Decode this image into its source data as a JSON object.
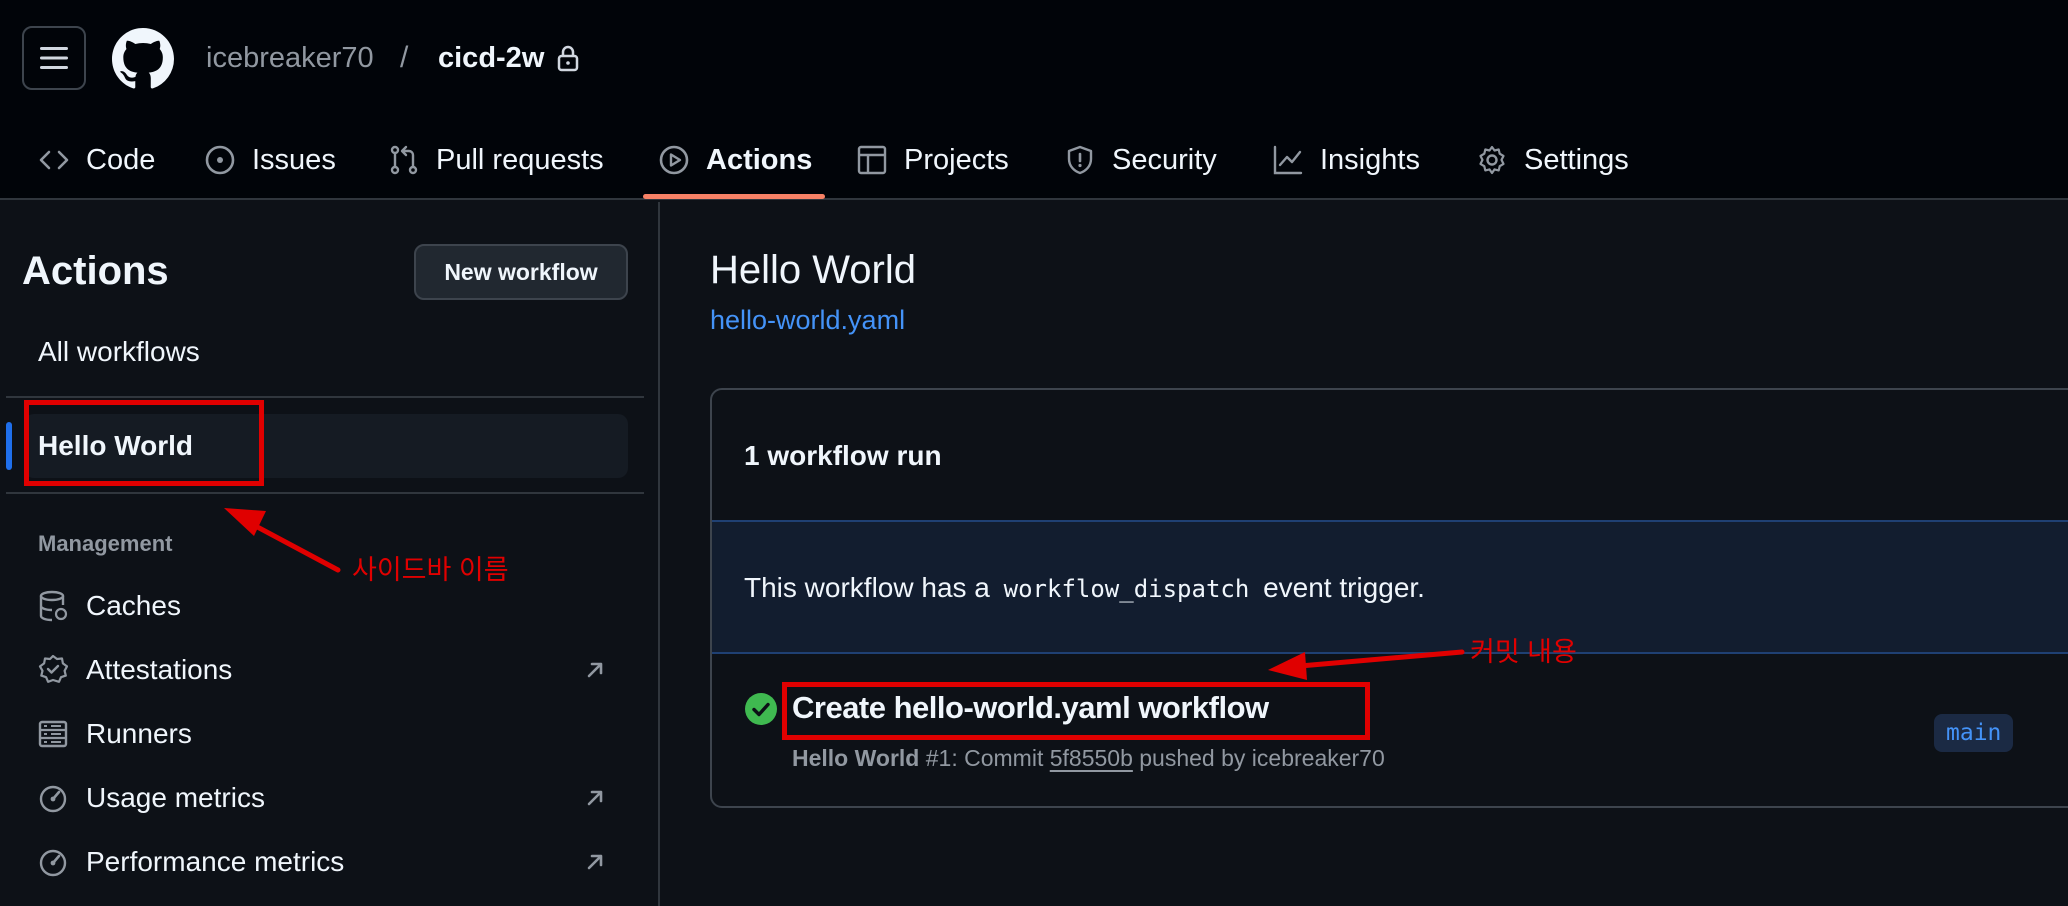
{
  "header": {
    "owner": "icebreaker70",
    "separator": "/",
    "repo": "cicd-2w"
  },
  "tabs": [
    {
      "label": "Code",
      "icon": "code-icon"
    },
    {
      "label": "Issues",
      "icon": "issue-opened-icon"
    },
    {
      "label": "Pull requests",
      "icon": "git-pull-request-icon"
    },
    {
      "label": "Actions",
      "icon": "play-icon",
      "active": true
    },
    {
      "label": "Projects",
      "icon": "table-icon"
    },
    {
      "label": "Security",
      "icon": "shield-icon"
    },
    {
      "label": "Insights",
      "icon": "graph-icon"
    },
    {
      "label": "Settings",
      "icon": "gear-icon"
    }
  ],
  "sidebar": {
    "title": "Actions",
    "new_workflow": "New workflow",
    "all_workflows": "All workflows",
    "selected_workflow": "Hello World",
    "management_heading": "Management",
    "management_items": [
      {
        "label": "Caches",
        "icon": "database-icon"
      },
      {
        "label": "Attestations",
        "icon": "verified-icon"
      },
      {
        "label": "Runners",
        "icon": "server-icon"
      },
      {
        "label": "Usage metrics",
        "icon": "meter-icon"
      },
      {
        "label": "Performance metrics",
        "icon": "meter-icon"
      }
    ]
  },
  "main": {
    "title": "Hello World",
    "file": "hello-world.yaml",
    "run_count": "1 workflow run",
    "dispatch": {
      "prefix": "This workflow has a",
      "code": "workflow_dispatch",
      "suffix": "event trigger."
    },
    "run": {
      "title": "Create hello-world.yaml workflow",
      "workflow": "Hello World",
      "number": "#1: Commit",
      "sha": "5f8550b",
      "pushed_by": "pushed by icebreaker70",
      "branch": "main",
      "status_color": "#3fb950"
    }
  },
  "annotations": {
    "sidebar_note": "사이드바 이름",
    "commit_note": "커밋 내용",
    "color": "#e00000"
  }
}
